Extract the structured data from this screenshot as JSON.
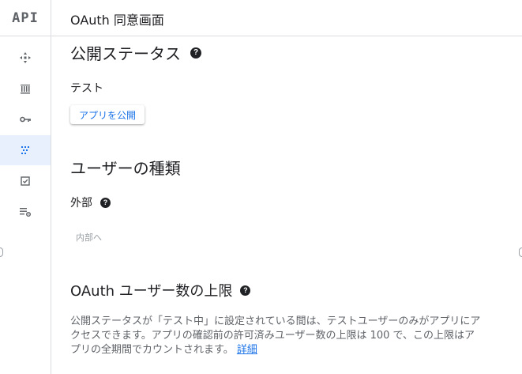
{
  "app": {
    "logo_text": "API",
    "page_title": "OAuth 同意画面"
  },
  "sidebar": {
    "items": [
      {
        "name": "dashboard-icon"
      },
      {
        "name": "library-icon"
      },
      {
        "name": "key-icon"
      },
      {
        "name": "consent-screen-icon",
        "active": true
      },
      {
        "name": "checkbox-icon"
      },
      {
        "name": "settings-list-icon"
      }
    ],
    "accent_color": "#1a73e8",
    "active_bg": "#e8f0fe"
  },
  "publish_status": {
    "heading": "公開ステータス",
    "status": "テスト",
    "publish_button": "アプリを公開"
  },
  "user_type": {
    "heading": "ユーザーの種類",
    "value": "外部",
    "switch_link": "内部へ"
  },
  "user_cap": {
    "heading": "OAuth ユーザー数の上限",
    "description": "公開ステータスが「テスト中」に設定されている間は、テストユーザーのみがアプリにアクセスできます。アプリの確認前の許可済みユーザー数の上限は 100 で、この上限はアプリの全期間でカウントされます。",
    "learn_more": "詳細"
  }
}
